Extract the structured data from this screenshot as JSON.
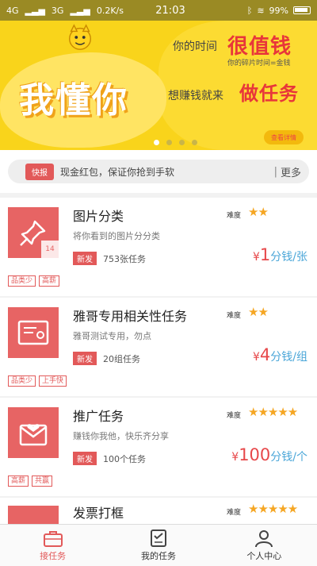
{
  "status_bar": {
    "signal_left": "4G",
    "signal_right": "3G",
    "speed": "0.2K/s",
    "time": "21:03",
    "battery": "99%"
  },
  "banner": {
    "big_text": "我懂你",
    "line1_small": "你的时间",
    "line1_big": "很值钱",
    "line1_sub": "你的碎片时间=金钱",
    "line2_small": "想赚钱就来",
    "line2_big": "做任务",
    "see_detail": "查看详情",
    "pages": 4,
    "active_page": 0
  },
  "notice": {
    "tag": "快报",
    "message": "现金红包，保证你抢到手软",
    "divider": "|",
    "more": "更多"
  },
  "tasks": [
    {
      "title": "图片分类",
      "desc": "将你看到的图片分分类",
      "new": "新发",
      "count": "753张任务",
      "difficulty_label": "难度",
      "stars": "★★",
      "price_symbol": "¥",
      "price_value": "1",
      "price_unit": "分钱/张",
      "icon_badge": "14",
      "tags": [
        "品类少",
        "高薪"
      ]
    },
    {
      "title": "雅哥专用相关性任务",
      "desc": "雅哥测试专用，勿点",
      "new": "新发",
      "count": "20组任务",
      "difficulty_label": "难度",
      "stars": "★★",
      "price_symbol": "¥",
      "price_value": "4",
      "price_unit": "分钱/组",
      "tags": [
        "品类少",
        "上手快"
      ]
    },
    {
      "title": "推广任务",
      "desc": "赚钱你我他，快乐齐分享",
      "new": "新发",
      "count": "100个任务",
      "difficulty_label": "难度",
      "stars": "★★★★★",
      "price_symbol": "¥",
      "price_value": "100",
      "price_unit": "分钱/个",
      "tags": [
        "高薪",
        "共赢"
      ]
    },
    {
      "title": "发票打框",
      "difficulty_label": "难度",
      "stars": "★★★★★"
    }
  ],
  "bottom_nav": [
    {
      "label": "接任务",
      "icon": "briefcase-icon"
    },
    {
      "label": "我的任务",
      "icon": "task-list-icon"
    },
    {
      "label": "个人中心",
      "icon": "person-icon"
    }
  ],
  "colors": {
    "accent_red": "#e25959",
    "banner_yellow": "#f9d41b",
    "price_blue": "#4aa6d8",
    "star_orange": "#f5a623"
  }
}
